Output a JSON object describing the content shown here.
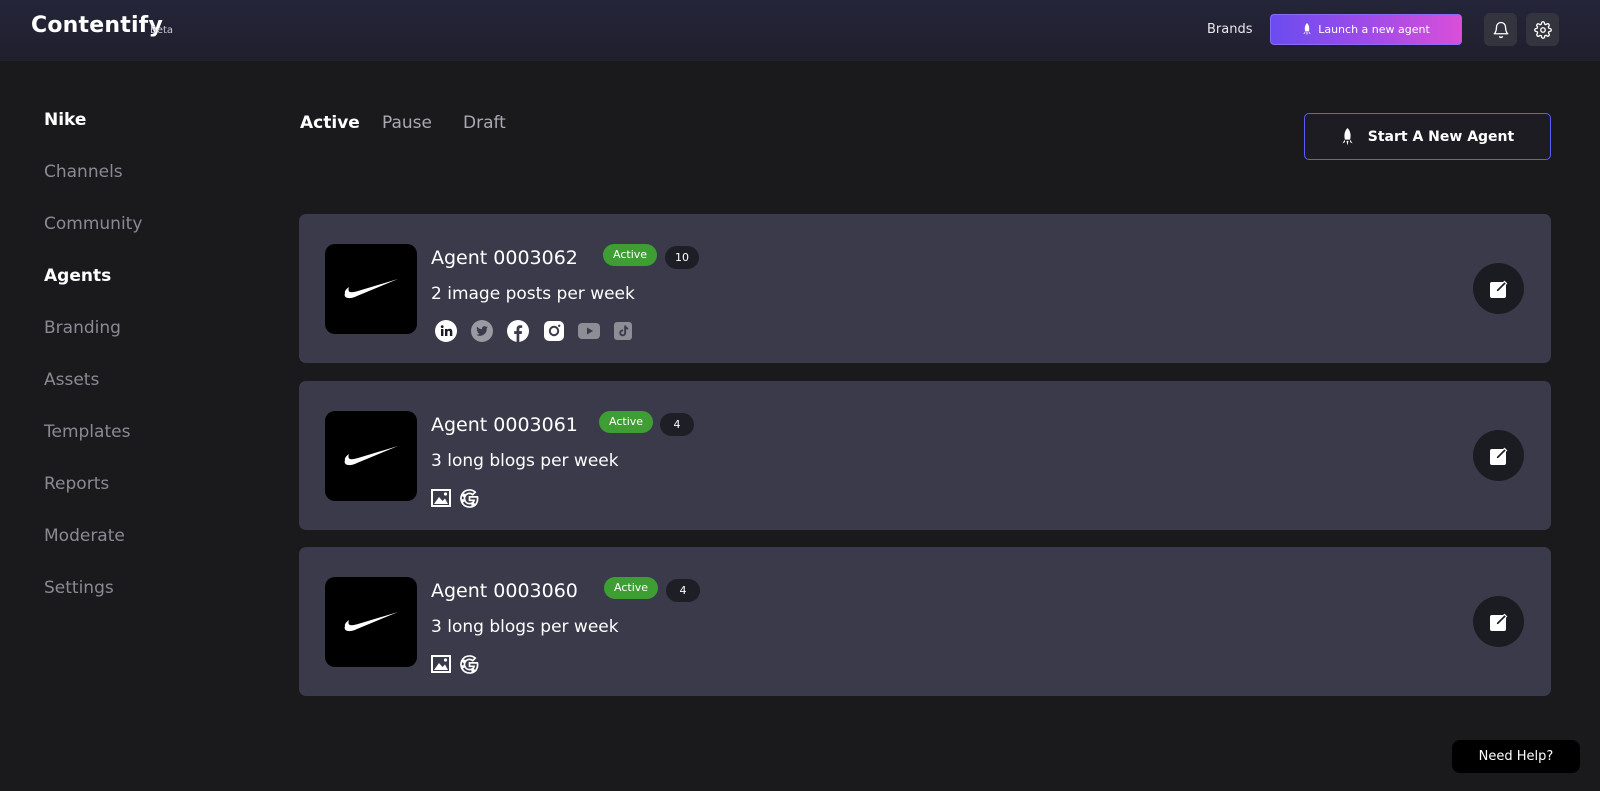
{
  "header": {
    "app_name": "Contentify",
    "beta_label": "Beta",
    "brands_label": "Brands",
    "launch_label": "Launch a new agent",
    "accent_gradient": [
      "#6a4cf0",
      "#d94fd8"
    ]
  },
  "sidebar": {
    "brand": "Nike",
    "items": [
      {
        "label": "Channels",
        "active": false
      },
      {
        "label": "Community",
        "active": false
      },
      {
        "label": "Agents",
        "active": true
      },
      {
        "label": "Branding",
        "active": false
      },
      {
        "label": "Assets",
        "active": false
      },
      {
        "label": "Templates",
        "active": false
      },
      {
        "label": "Reports",
        "active": false
      },
      {
        "label": "Moderate",
        "active": false
      },
      {
        "label": "Settings",
        "active": false
      }
    ]
  },
  "tabs": [
    {
      "label": "Active",
      "active": true
    },
    {
      "label": "Pause",
      "active": false
    },
    {
      "label": "Draft",
      "active": false
    }
  ],
  "start_agent_label": "Start A New Agent",
  "agents": [
    {
      "name": "Agent 0003062",
      "status": "Active",
      "count": "10",
      "schedule": "2 image posts per week",
      "channels": [
        "linkedin-icon",
        "twitter-icon",
        "facebook-icon",
        "instagram-icon",
        "youtube-icon",
        "tiktok-icon"
      ]
    },
    {
      "name": "Agent 0003061",
      "status": "Active",
      "count": "4",
      "schedule": "3 long blogs per week",
      "channels": [
        "image-icon",
        "google-icon"
      ]
    },
    {
      "name": "Agent 0003060",
      "status": "Active",
      "count": "4",
      "schedule": "3 long blogs per week",
      "channels": [
        "image-icon",
        "google-icon"
      ]
    }
  ],
  "help_label": "Need Help?",
  "colors": {
    "status_active": "#3f9e33",
    "card_bg": "#3a3a4a",
    "page_bg": "#1a1a1c",
    "outline_accent": "#5b5ef0"
  }
}
